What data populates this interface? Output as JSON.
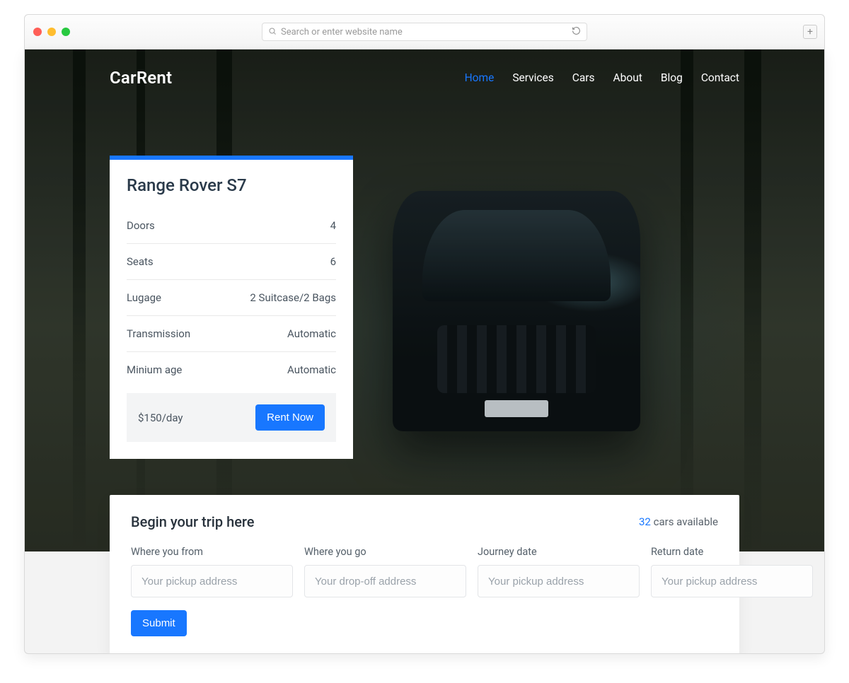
{
  "chrome": {
    "address_placeholder": "Search or enter website name"
  },
  "nav": {
    "brand": "CarRent",
    "items": [
      "Home",
      "Services",
      "Cars",
      "About",
      "Blog",
      "Contact"
    ],
    "active_index": 0
  },
  "card": {
    "title": "Range Rover S7",
    "specs": [
      {
        "label": "Doors",
        "value": "4"
      },
      {
        "label": "Seats",
        "value": "6"
      },
      {
        "label": "Lugage",
        "value": "2 Suitcase/2 Bags"
      },
      {
        "label": "Transmission",
        "value": "Automatic"
      },
      {
        "label": "Minium age",
        "value": "Automatic"
      }
    ],
    "price": "$150/day",
    "cta": "Rent Now"
  },
  "trip": {
    "title": "Begin your trip here",
    "available_count": "32",
    "available_suffix": " cars available",
    "fields": [
      {
        "label": "Where you from",
        "placeholder": "Your pickup address"
      },
      {
        "label": "Where you go",
        "placeholder": "Your drop-off address"
      },
      {
        "label": "Journey date",
        "placeholder": "Your pickup address"
      },
      {
        "label": "Return date",
        "placeholder": "Your pickup address"
      }
    ],
    "submit": "Submit"
  },
  "colors": {
    "accent": "#1877ff"
  }
}
